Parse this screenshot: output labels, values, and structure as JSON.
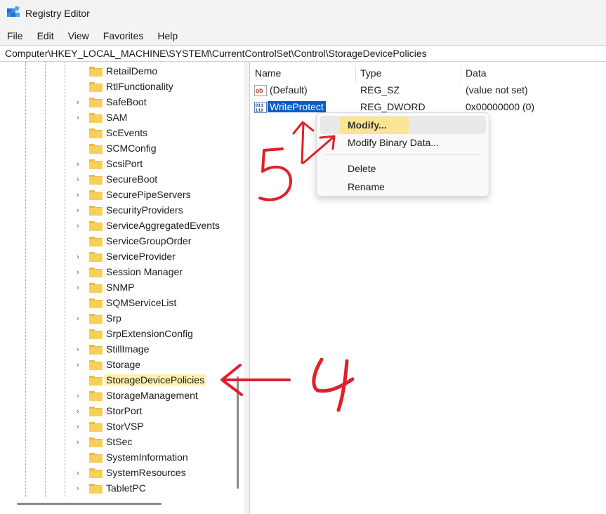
{
  "window": {
    "title": "Registry Editor"
  },
  "menu": [
    "File",
    "Edit",
    "View",
    "Favorites",
    "Help"
  ],
  "address": "Computer\\HKEY_LOCAL_MACHINE\\SYSTEM\\CurrentControlSet\\Control\\StorageDevicePolicies",
  "tree": {
    "items": [
      {
        "label": "RetailDemo",
        "expandable": false
      },
      {
        "label": "RtlFunctionality",
        "expandable": false
      },
      {
        "label": "SafeBoot",
        "expandable": true
      },
      {
        "label": "SAM",
        "expandable": true
      },
      {
        "label": "ScEvents",
        "expandable": false
      },
      {
        "label": "SCMConfig",
        "expandable": false
      },
      {
        "label": "ScsiPort",
        "expandable": true
      },
      {
        "label": "SecureBoot",
        "expandable": true
      },
      {
        "label": "SecurePipeServers",
        "expandable": true
      },
      {
        "label": "SecurityProviders",
        "expandable": true
      },
      {
        "label": "ServiceAggregatedEvents",
        "expandable": true
      },
      {
        "label": "ServiceGroupOrder",
        "expandable": false
      },
      {
        "label": "ServiceProvider",
        "expandable": true
      },
      {
        "label": "Session Manager",
        "expandable": true
      },
      {
        "label": "SNMP",
        "expandable": true
      },
      {
        "label": "SQMServiceList",
        "expandable": false
      },
      {
        "label": "Srp",
        "expandable": true
      },
      {
        "label": "SrpExtensionConfig",
        "expandable": false
      },
      {
        "label": "StillImage",
        "expandable": true
      },
      {
        "label": "Storage",
        "expandable": true
      },
      {
        "label": "StorageDevicePolicies",
        "expandable": false,
        "selected": true
      },
      {
        "label": "StorageManagement",
        "expandable": true
      },
      {
        "label": "StorPort",
        "expandable": true
      },
      {
        "label": "StorVSP",
        "expandable": true
      },
      {
        "label": "StSec",
        "expandable": true
      },
      {
        "label": "SystemInformation",
        "expandable": false
      },
      {
        "label": "SystemResources",
        "expandable": true
      },
      {
        "label": "TabletPC",
        "expandable": true
      }
    ]
  },
  "values": {
    "headers": {
      "name": "Name",
      "type": "Type",
      "data": "Data"
    },
    "rows": [
      {
        "name": "(Default)",
        "type": "REG_SZ",
        "data": "(value not set)",
        "icon": "string-value-icon"
      },
      {
        "name": "WriteProtect",
        "type": "REG_DWORD",
        "data": "0x00000000 (0)",
        "icon": "binary-value-icon",
        "selected": true
      }
    ]
  },
  "context_menu": {
    "modify": "Modify...",
    "modify_binary": "Modify Binary Data...",
    "delete": "Delete",
    "rename": "Rename"
  },
  "annotations": {
    "step4": "4",
    "step5": "5",
    "color": "#e0202a"
  },
  "colors": {
    "selection": "#0a5cc2",
    "highlight": "#ffe26e",
    "folder": "#f8cf5a"
  }
}
